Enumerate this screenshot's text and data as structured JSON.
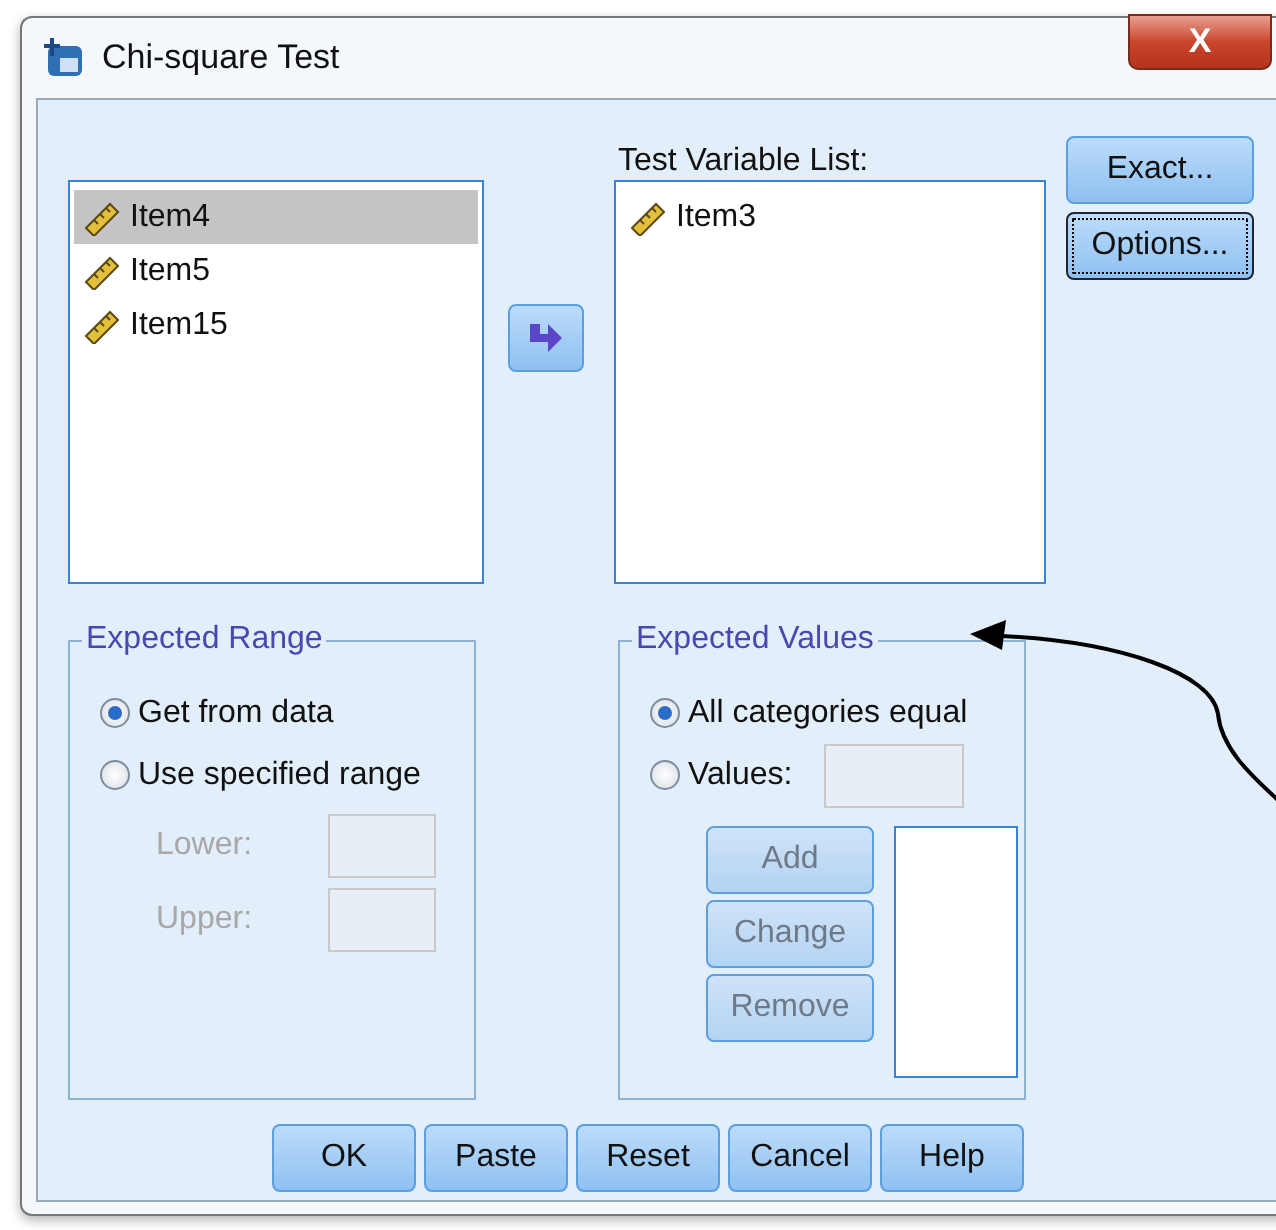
{
  "window": {
    "title": "Chi-square Test",
    "close_label": "X"
  },
  "source_list": {
    "items": [
      {
        "label": "Item4",
        "selected": true
      },
      {
        "label": "Item5",
        "selected": false
      },
      {
        "label": "Item15",
        "selected": false
      }
    ]
  },
  "target_list": {
    "label": "Test Variable List:",
    "items": [
      {
        "label": "Item3",
        "selected": false
      }
    ]
  },
  "side_buttons": [
    {
      "label": "Exact...",
      "focused": false
    },
    {
      "label": "Options...",
      "focused": true
    }
  ],
  "expected_range": {
    "title": "Expected Range",
    "options": [
      {
        "label": "Get from data",
        "selected": true
      },
      {
        "label": "Use specified range",
        "selected": false
      }
    ],
    "fields": [
      {
        "label": "Lower:",
        "disabled": true
      },
      {
        "label": "Upper:",
        "disabled": true
      }
    ]
  },
  "expected_values": {
    "title": "Expected Values",
    "options": [
      {
        "label": "All categories equal",
        "selected": true
      },
      {
        "label": "Values:",
        "selected": false
      }
    ],
    "buttons": [
      {
        "label": "Add",
        "disabled": true
      },
      {
        "label": "Change",
        "disabled": true
      },
      {
        "label": "Remove",
        "disabled": true
      }
    ]
  },
  "buttons": [
    {
      "label": "OK"
    },
    {
      "label": "Paste"
    },
    {
      "label": "Reset"
    },
    {
      "label": "Cancel"
    },
    {
      "label": "Help"
    }
  ]
}
